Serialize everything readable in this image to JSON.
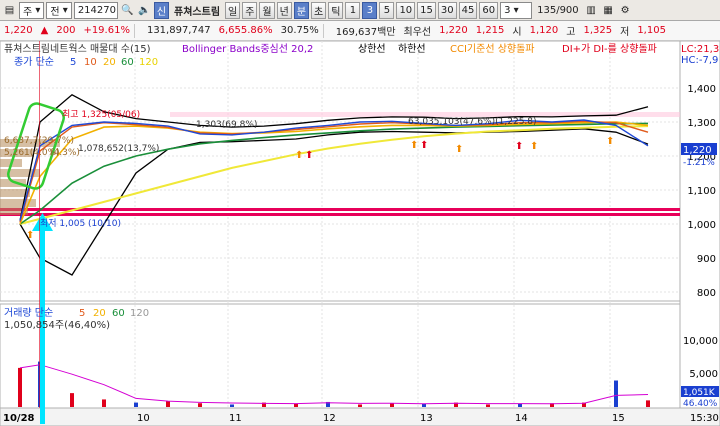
{
  "toolbar": {
    "market_select": "주",
    "period_select": "전",
    "code": "214270",
    "name": "퓨쳐스트림",
    "tag": "신",
    "period_buttons": [
      "일",
      "주",
      "월",
      "년"
    ],
    "tick_buttons": [
      "분",
      "초",
      "틱"
    ],
    "interval_buttons": [
      "1",
      "3",
      "5",
      "10",
      "15",
      "30",
      "45",
      "60"
    ],
    "interval_value": "3",
    "count": "135/900"
  },
  "quote": {
    "price": "1,220",
    "change": "200",
    "change_pct": "+19.61%",
    "volume": "131,897,747",
    "volume_pct": "6,655.86%",
    "turnover_rate": "30.75%",
    "amount": "169,637백만",
    "best_label": "최우선",
    "best_ask": "1,220",
    "best_bid": "1,215",
    "open_label": "시",
    "open": "1,120",
    "high_label": "고",
    "high": "1,325",
    "low_label": "저",
    "low": "1,105"
  },
  "price_panel": {
    "title": "퓨쳐스트림네트웍스 매물대 수(15)",
    "bollinger": "Bollinger Bands중심선 20,2",
    "upper": "상한선",
    "lower": "하한선",
    "cci": "CCI기준선 상향돌파",
    "dmi": "DI+가 DI-를 상향돌파",
    "lc": "LC:21,3",
    "hc": "HC:-7,9",
    "ma_label": "종가 단순",
    "ma_periods": [
      "5",
      "10",
      "20",
      "60",
      "120"
    ],
    "annot_high": "최고 1,325(05/06)",
    "annot_mid": "1,303(69.8%)",
    "annot_right": "63,035,103(47.6%)(1,225.8)",
    "annot_vol1": "6,637,7(29.7%)",
    "annot_vol2": "1,078,652(13,7%)",
    "annot_vol3": "5,261(4.0%)",
    "annot_vol4": "(4.3%)",
    "annot_low": "최저 1,005 (10/10)",
    "price_tag": "1,220",
    "price_tag_pct": "-1.21%",
    "yticks": [
      "1,400",
      "1,300",
      "1,200",
      "1,100",
      "1,000",
      "900",
      "800"
    ]
  },
  "volume_panel": {
    "label": "거래량 단순",
    "ma_periods": [
      "5",
      "20",
      "60",
      "120"
    ],
    "annot": "1,050,854주(46,40%)",
    "yticks": [
      "10,000",
      "5,000"
    ],
    "tag": "1,051K",
    "tag_pct": "46.40%"
  },
  "xaxis": {
    "labels": [
      "10/28",
      "10",
      "11",
      "12",
      "13",
      "14",
      "15"
    ],
    "time": "15:30:0"
  },
  "colors": {
    "up": "#e0001b",
    "down": "#1a3fd0",
    "ma5": "#1f49d6",
    "ma10": "#e05a1b",
    "ma20": "#f2b100",
    "ma60": "#1a8f3a",
    "ma120": "#f0e838",
    "bb": "#000000",
    "support": "#e8005a",
    "highlight": "#33cc33",
    "cyan": "#00e5ff"
  },
  "chart_data": {
    "type": "candlestick",
    "price_ylim": [
      760,
      1440
    ],
    "volume_ylim": [
      0,
      13000
    ],
    "dates": [
      "10/28",
      "10",
      "11",
      "12",
      "13",
      "14",
      "15"
    ],
    "price_series": [
      {
        "name": "5",
        "values": [
          1010,
          1230,
          1290,
          1300,
          1296,
          1288,
          1265,
          1262,
          1270,
          1282,
          1290,
          1300,
          1302,
          1296,
          1290,
          1295,
          1305,
          1300,
          1306,
          1290,
          1230
        ]
      },
      {
        "name": "10",
        "values": [
          1005,
          1215,
          1285,
          1298,
          1292,
          1284,
          1268,
          1265,
          1270,
          1278,
          1286,
          1294,
          1298,
          1294,
          1290,
          1292,
          1298,
          1298,
          1302,
          1298,
          1270
        ]
      },
      {
        "name": "20",
        "values": [
          1000,
          1140,
          1250,
          1285,
          1288,
          1282,
          1270,
          1266,
          1268,
          1272,
          1280,
          1286,
          1290,
          1290,
          1288,
          1290,
          1293,
          1295,
          1298,
          1300,
          1290
        ]
      },
      {
        "name": "60",
        "values": [
          1000,
          1040,
          1120,
          1170,
          1200,
          1220,
          1236,
          1246,
          1254,
          1262,
          1268,
          1274,
          1279,
          1282,
          1285,
          1287,
          1289,
          1291,
          1293,
          1295,
          1296
        ]
      },
      {
        "name": "120",
        "values": [
          1000,
          1015,
          1040,
          1065,
          1090,
          1115,
          1140,
          1165,
          1185,
          1205,
          1222,
          1236,
          1248,
          1258,
          1266,
          1272,
          1276,
          1280,
          1283,
          1286,
          1288
        ]
      }
    ],
    "bollinger": {
      "upper": [
        1010,
        1300,
        1380,
        1330,
        1310,
        1300,
        1290,
        1285,
        1288,
        1295,
        1305,
        1312,
        1315,
        1314,
        1310,
        1312,
        1316,
        1315,
        1318,
        1320,
        1345
      ],
      "lower": [
        1000,
        900,
        850,
        1000,
        1150,
        1220,
        1240,
        1242,
        1246,
        1250,
        1262,
        1270,
        1272,
        1270,
        1268,
        1270,
        1272,
        1276,
        1280,
        1270,
        1235
      ]
    },
    "volume": [
      6200,
      7200,
      2200,
      1200,
      700,
      900,
      600,
      400,
      700,
      500,
      800,
      400,
      600,
      500,
      700,
      400,
      500,
      600,
      700,
      4200,
      1050
    ]
  }
}
